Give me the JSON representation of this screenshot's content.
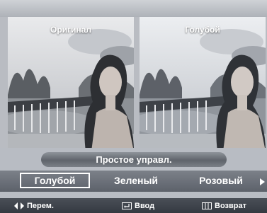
{
  "previews": {
    "left_label": "Оригинал",
    "right_label": "Голубой"
  },
  "mode_title": "Простое управл.",
  "options": [
    {
      "label": "Голубой",
      "selected": true
    },
    {
      "label": "Зеленый",
      "selected": false
    },
    {
      "label": "Розовый",
      "selected": false
    }
  ],
  "help": {
    "move": "Перем.",
    "enter": "Ввод",
    "return": "Возврат"
  },
  "icons": [
    "left-right-arrows-icon",
    "enter-icon",
    "return-icon",
    "right-arrow-icon"
  ]
}
